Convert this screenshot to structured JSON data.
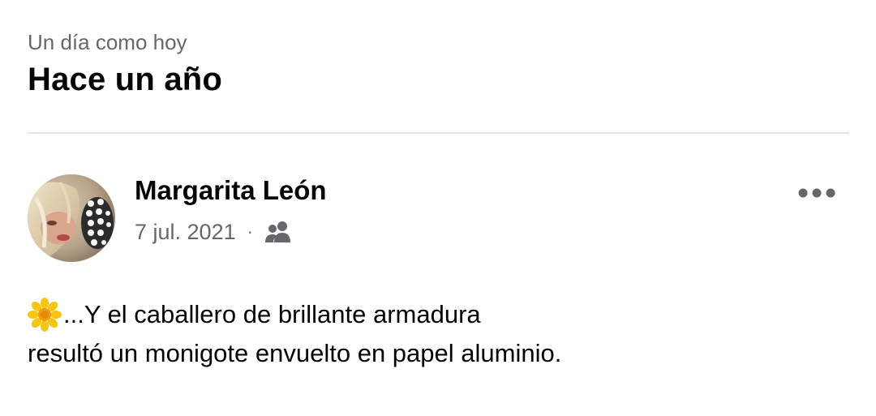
{
  "memory": {
    "subtitle": "Un día como hoy",
    "title": "Hace un año"
  },
  "post": {
    "author": "Margarita León",
    "date": "7 jul. 2021",
    "separator": "·",
    "audience_icon": "friends-icon",
    "more_icon": "more-options-icon",
    "line1": "...Y el caballero de brillante armadura",
    "line2": "resultó un monigote envuelto en papel aluminio.",
    "leading_emoji": "blossom-icon"
  },
  "colors": {
    "primary_text": "#050505",
    "secondary_text": "#65676b",
    "divider": "#e4e6eb"
  }
}
